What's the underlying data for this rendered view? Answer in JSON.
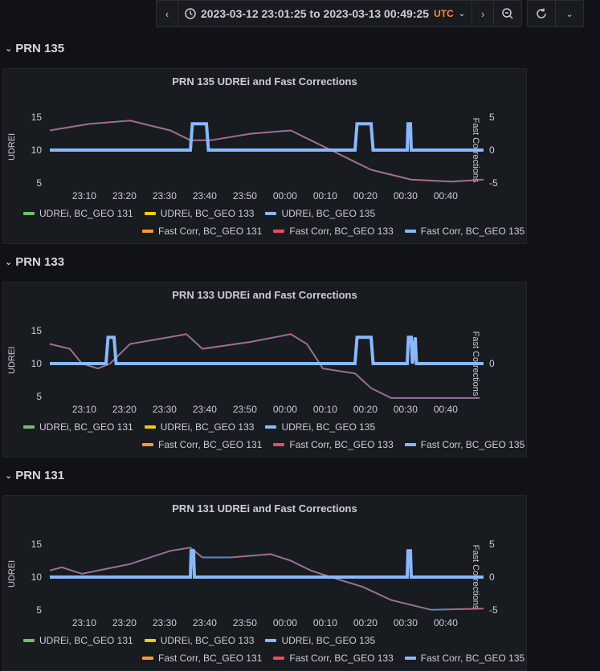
{
  "toolbar": {
    "range_text": "2023-03-12 23:01:25 to 2023-03-13 00:49:25",
    "timezone": "UTC",
    "icons": [
      "chevron-left-icon",
      "clock-icon",
      "chevron-down-icon",
      "chevron-right-icon",
      "zoom-out-icon",
      "refresh-icon",
      "chevron-down-icon"
    ]
  },
  "colors": {
    "udrei_131": "#73bf69",
    "udrei_133": "#f2cc0c",
    "udrei_135": "#8ab8ff",
    "fc_131": "#ff9830",
    "fc_133": "#f2495c",
    "fc_135": "#8ab8ff"
  },
  "legend": {
    "row1": [
      "UDREi, BC_GEO 131",
      "UDREi, BC_GEO 133",
      "UDREi, BC_GEO 135"
    ],
    "row2": [
      "Fast Corr, BC_GEO 131",
      "Fast Corr, BC_GEO 133",
      "Fast Corr, BC_GEO 135"
    ]
  },
  "rows": [
    {
      "label": "PRN 135"
    },
    {
      "label": "PRN 133"
    },
    {
      "label": "PRN 131"
    }
  ],
  "chart_data": [
    {
      "type": "line",
      "title": "PRN 135 UDREi and Fast Corrections",
      "ylabel": "UDREI",
      "ylabel_right": "Fast Corrections",
      "x_ticks": [
        "23:10",
        "23:20",
        "23:30",
        "23:40",
        "23:50",
        "00:00",
        "00:10",
        "00:20",
        "00:30",
        "00:40"
      ],
      "y_ticks_left": [
        "15",
        "10",
        "5"
      ],
      "y_ticks_right": [
        "5",
        "0",
        "-5"
      ],
      "ylim": [
        4,
        16
      ],
      "ylim_right": [
        -6,
        6
      ],
      "x_minutes_since": "2023-03-12 23:01:25",
      "series": [
        {
          "name": "Fast Corr, BC_GEO 133",
          "axis": "right",
          "x": [
            0,
            10,
            20,
            30,
            35,
            40,
            50,
            60,
            65,
            70,
            75,
            80,
            90,
            100,
            108
          ],
          "y": [
            3,
            4,
            4.5,
            3,
            1.5,
            1.5,
            2.5,
            3,
            1.5,
            0,
            -1.5,
            -3,
            -4.5,
            -4.8,
            -4.5
          ]
        },
        {
          "name": "UDREi, BC_GEO 135",
          "axis": "left",
          "step": true,
          "x": [
            0,
            35,
            35.5,
            39,
            39.5,
            76,
            76.5,
            80,
            80.5,
            89,
            89.2,
            89.8,
            90,
            108
          ],
          "y": [
            10,
            10,
            14,
            14,
            10,
            10,
            14,
            14,
            10,
            10,
            14,
            14,
            10,
            10
          ]
        }
      ]
    },
    {
      "type": "line",
      "title": "PRN 133 UDREi and Fast Corrections",
      "ylabel": "UDREI",
      "ylabel_right": "Fast Corrections",
      "x_ticks": [
        "23:10",
        "23:20",
        "23:30",
        "23:40",
        "23:50",
        "00:00",
        "00:10",
        "00:20",
        "00:30",
        "00:40"
      ],
      "y_ticks_left": [
        "15",
        "10",
        "5"
      ],
      "y_ticks_right": [
        "0"
      ],
      "ylim": [
        4,
        16
      ],
      "ylim_right": [
        -4,
        4
      ],
      "series": [
        {
          "name": "Fast Corr, BC_GEO 133",
          "axis": "right",
          "x": [
            0,
            5,
            8,
            12,
            15,
            20,
            30,
            34,
            38,
            50,
            60,
            64,
            68,
            76,
            80,
            85,
            90,
            100,
            107
          ],
          "y": [
            2,
            1.5,
            0,
            -0.5,
            0,
            2,
            2.7,
            3,
            1.5,
            2.2,
            3,
            2,
            -0.5,
            -1,
            -2.5,
            -3.5,
            -3.5,
            -3.5,
            -3.5
          ]
        },
        {
          "name": "UDREi, BC_GEO 135",
          "axis": "left",
          "step": true,
          "x": [
            0,
            14,
            14.5,
            16,
            16.5,
            76,
            76.5,
            80,
            80.5,
            89,
            89.3,
            90,
            90.3,
            91,
            91.3,
            108
          ],
          "y": [
            10,
            10,
            14,
            14,
            10,
            10,
            14,
            14,
            10,
            10,
            14,
            14,
            10,
            14,
            10,
            10
          ]
        }
      ]
    },
    {
      "type": "line",
      "title": "PRN 131 UDREi and Fast Corrections",
      "ylabel": "UDREI",
      "ylabel_right": "Fast Corrections",
      "x_ticks": [
        "23:10",
        "23:20",
        "23:30",
        "23:40",
        "23:50",
        "00:00",
        "00:10",
        "00:20",
        "00:30",
        "00:40"
      ],
      "y_ticks_left": [
        "15",
        "10",
        "5"
      ],
      "y_ticks_right": [
        "5",
        "0",
        "-5"
      ],
      "ylim": [
        4,
        16
      ],
      "ylim_right": [
        -6,
        6
      ],
      "series": [
        {
          "name": "Fast Corr, BC_GEO 133",
          "axis": "right",
          "x": [
            0,
            3,
            8,
            20,
            30,
            35,
            38,
            45,
            55,
            60,
            65,
            70,
            78,
            85,
            95,
            108
          ],
          "y": [
            1,
            1.5,
            0.5,
            2,
            4,
            4.5,
            3,
            3,
            3.5,
            2.5,
            1,
            0,
            -1.5,
            -3.5,
            -5,
            -4.8
          ]
        },
        {
          "name": "UDREi, BC_GEO 135",
          "axis": "left",
          "step": true,
          "x": [
            0,
            35,
            35.2,
            35.8,
            36,
            89,
            89.2,
            89.8,
            90,
            108
          ],
          "y": [
            10,
            10,
            14,
            14,
            10,
            10,
            14,
            14,
            10,
            10
          ]
        }
      ]
    }
  ]
}
